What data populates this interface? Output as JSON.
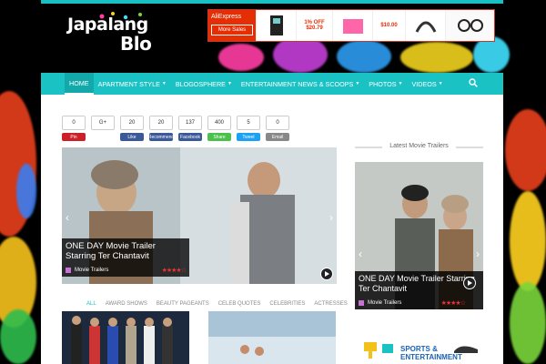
{
  "brand": {
    "line1": "Japalang",
    "line2": "Blo"
  },
  "ad": {
    "brand": "AliExpress",
    "button": "More Sales",
    "prices": [
      "1% OFF",
      "$20.79",
      "$10.00"
    ]
  },
  "nav": {
    "items": [
      {
        "label": "HOME",
        "active": true,
        "dropdown": false
      },
      {
        "label": "APARTMENT STYLE",
        "dropdown": true
      },
      {
        "label": "BLOGOSPHERE",
        "dropdown": true
      },
      {
        "label": "ENTERTAINMENT NEWS & SCOOPS",
        "dropdown": true
      },
      {
        "label": "PHOTOS",
        "dropdown": true
      },
      {
        "label": "VIDEOS",
        "dropdown": true
      }
    ],
    "search_icon": "search-icon"
  },
  "share": [
    {
      "count": "0",
      "label": "Pin",
      "color": "#cb2027"
    },
    {
      "count": "G+",
      "label": "",
      "color": "#dd4b39"
    },
    {
      "count": "20",
      "label": "Like",
      "color": "#3b5998"
    },
    {
      "count": "20",
      "label": "Recommend",
      "color": "#3b5998"
    },
    {
      "count": "137",
      "label": "Facebook",
      "color": "#3b5998"
    },
    {
      "count": "400",
      "label": "Share",
      "color": "#4cc04c"
    },
    {
      "count": "5",
      "label": "Tweet",
      "color": "#1da1f2"
    },
    {
      "count": "0",
      "label": "Email",
      "color": "#888888"
    }
  ],
  "main_slide": {
    "title": "ONE DAY Movie Trailer Starring Ter Chantavit",
    "category": "Movie Trailers",
    "rating_stars": 4,
    "rating_max": 5
  },
  "tabs": [
    "ALL",
    "AWARD SHOWS",
    "BEAUTY PAGEANTS",
    "CELEB QUOTES",
    "CELEBRITIES",
    "ACTRESSES"
  ],
  "sidebar": {
    "title": "Latest Movie Trailers",
    "slide_title": "ONE DAY Movie Trailer Starring Ter Chantavit",
    "slide_category": "Movie Trailers",
    "rating_stars": 4,
    "ad_text_1": "SPORTS &",
    "ad_text_2": "ENTERTAINMENT"
  },
  "colors": {
    "accent": "#1bc2c4",
    "category": "#c872d4",
    "rating": "#e33333"
  }
}
